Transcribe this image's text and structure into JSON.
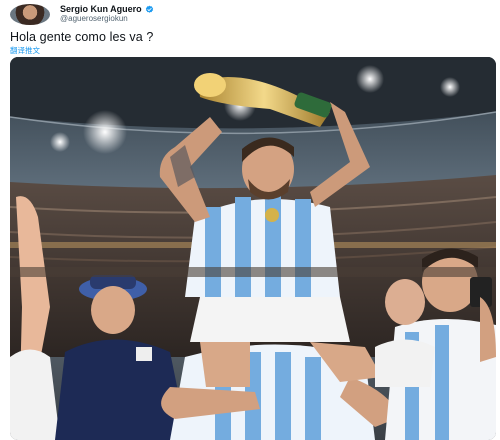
{
  "tweet": {
    "author_name": "Sergio Kun Aguero",
    "author_handle": "@aguerosergiokun",
    "text": "Hola gente como les va ?",
    "translate_label": "翻译推文"
  },
  "colors": {
    "accent": "#1d9bf0",
    "text": "#0f1419",
    "muted": "#536471"
  },
  "icons": {
    "verified": "verified-badge-icon"
  }
}
